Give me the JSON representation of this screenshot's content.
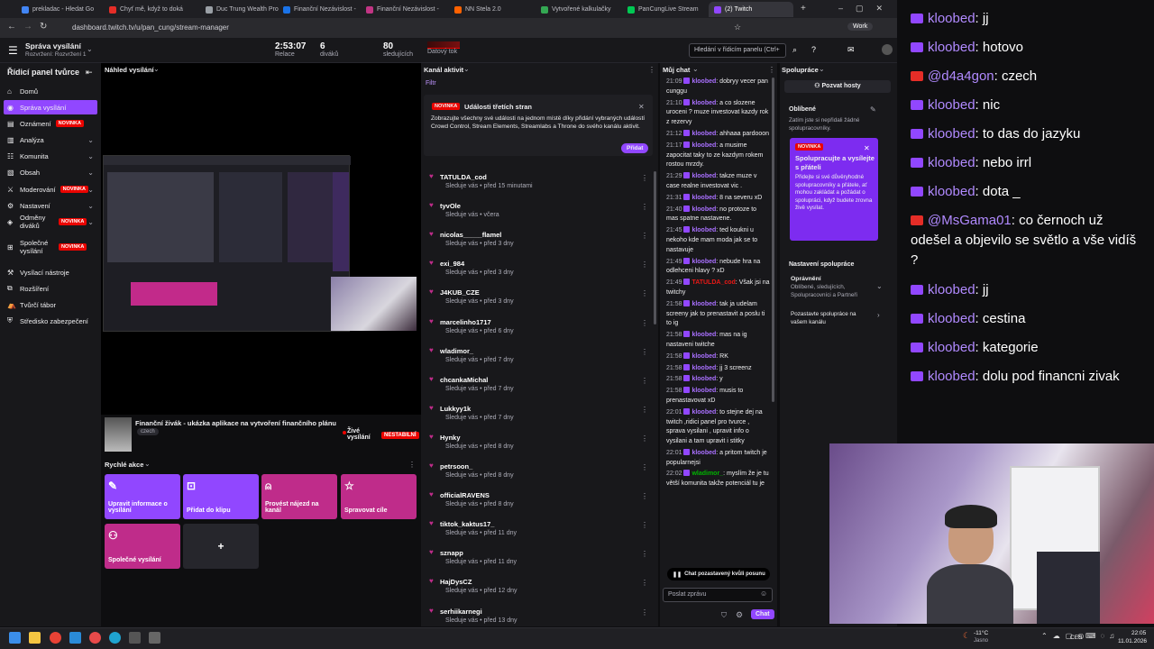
{
  "browser": {
    "tabs": [
      {
        "label": "prekladac - Hledat Go",
        "color": "#4285f4"
      },
      {
        "label": "Chyť mě, když to doká",
        "color": "#e52d27"
      },
      {
        "label": "Duc Trung Wealth Pro",
        "color": "#9aa0a6"
      },
      {
        "label": "Finanční Nezávislost -",
        "color": "#1a73e8"
      },
      {
        "label": "Finanční Nezávislost -",
        "color": "#c13584"
      },
      {
        "label": "NN Stela 2.0",
        "color": "#ff6200"
      },
      {
        "label": "Vytvořené kalkulačky",
        "color": "#34a853"
      },
      {
        "label": "PanCungLive Stream",
        "color": "#00c853"
      },
      {
        "label": "(2) Twitch",
        "color": "#9147ff"
      }
    ],
    "url": "dashboard.twitch.tv/u/pan_cung/stream-manager",
    "profile": "Work"
  },
  "twitch_header": {
    "title": "Správa vysílání",
    "subtitle": "Rozvržení: Rozvržení 1",
    "stats": [
      {
        "value": "2:53:07",
        "label": "Relace"
      },
      {
        "value": "6",
        "label": "diváků"
      },
      {
        "value": "80",
        "label": "sledujících"
      },
      {
        "value": "",
        "label": "Datový tok"
      }
    ],
    "search_placeholder": "Hledání v řídicím panelu (Ctrl+"
  },
  "left_nav": {
    "title": "Řídicí panel tvůrce",
    "items": [
      {
        "label": "Domů",
        "badge": "",
        "expand": false
      },
      {
        "label": "Správa vysílání",
        "badge": "",
        "expand": false,
        "active": true
      },
      {
        "label": "Oznámení",
        "badge": "NOVINKA",
        "expand": false
      },
      {
        "label": "Analýza",
        "badge": "",
        "expand": true
      },
      {
        "label": "Komunita",
        "badge": "",
        "expand": true
      },
      {
        "label": "Obsah",
        "badge": "",
        "expand": true
      },
      {
        "label": "Moderování",
        "badge": "NOVINKA",
        "expand": true
      },
      {
        "label": "Nastavení",
        "badge": "",
        "expand": true
      },
      {
        "label": "Odměny diváků",
        "badge": "NOVINKA",
        "expand": true
      },
      {
        "label": "Společné vysílání",
        "badge": "NOVINKA",
        "expand": false
      },
      {
        "label": "Vysílací nástroje",
        "badge": "",
        "expand": false
      },
      {
        "label": "Rozšíření",
        "badge": "",
        "expand": false
      },
      {
        "label": "Tvůrčí tábor",
        "badge": "",
        "expand": false
      },
      {
        "label": "Středisko zabezpečení",
        "badge": "",
        "expand": false
      }
    ]
  },
  "preview": {
    "header": "Náhled vysílání",
    "stream_title": "Finanční živák - ukázka aplikace na vytvoření finančního plánu",
    "language": "czech",
    "live_label": "Živé vysílání",
    "unstable_label": "NESTABILNÍ"
  },
  "quick_actions": {
    "header": "Rychlé akce",
    "items": [
      {
        "label": "Upravit informace o vysílání",
        "color": "#9147ff"
      },
      {
        "label": "Přidat do klipu",
        "color": "#9147ff"
      },
      {
        "label": "Provést nájezd na kanál",
        "color": "#bf2c8a"
      },
      {
        "label": "Spravovat cíle",
        "color": "#bf2c8a"
      },
      {
        "label": "Společné vysílání",
        "color": "#bf2c8a"
      },
      {
        "label": "+",
        "color": "#26262c"
      }
    ]
  },
  "activity": {
    "header": "Kanál aktivit",
    "filter": "Filtr",
    "promo_badge": "NOVINKA",
    "promo_title": "Události třetích stran",
    "promo_text": "Zobrazujte všechny své události na jednom místě díky přidání vybraných událostí Crowd Control, Stream Elements, Streamlabs a Throne do svého kanálu aktivit.",
    "promo_button": "Přidat",
    "followers": [
      {
        "name": "TATULDA_cod",
        "time": "Sleduje vás • před 15 minutami"
      },
      {
        "name": "tyvOle",
        "time": "Sleduje vás • včera"
      },
      {
        "name": "nicolas_____flamel",
        "time": "Sleduje vás • před 3 dny"
      },
      {
        "name": "exi_984",
        "time": "Sleduje vás • před 3 dny"
      },
      {
        "name": "J4KUB_CZE",
        "time": "Sleduje vás • před 3 dny"
      },
      {
        "name": "marcelinho1717",
        "time": "Sleduje vás • před 6 dny"
      },
      {
        "name": "wladimor_",
        "time": "Sleduje vás • před 7 dny"
      },
      {
        "name": "chcankaMichal",
        "time": "Sleduje vás • před 7 dny"
      },
      {
        "name": "Lukkyy1k",
        "time": "Sleduje vás • před 7 dny"
      },
      {
        "name": "Hynky",
        "time": "Sleduje vás • před 8 dny"
      },
      {
        "name": "petrsoon_",
        "time": "Sleduje vás • před 8 dny"
      },
      {
        "name": "officialRAVENS",
        "time": "Sleduje vás • před 8 dny"
      },
      {
        "name": "tiktok_kaktus17_",
        "time": "Sleduje vás • před 11 dny"
      },
      {
        "name": "sznapp",
        "time": "Sleduje vás • před 11 dny"
      },
      {
        "name": "HajDysCZ",
        "time": "Sleduje vás • před 12 dny"
      },
      {
        "name": "serhiikarnegi",
        "time": "Sleduje vás • před 13 dny"
      }
    ]
  },
  "my_chat": {
    "header": "Můj chat",
    "paused": "Chat pozastavený kvůli posunu",
    "input_placeholder": "Poslat zprávu",
    "send_label": "Chat",
    "messages": [
      {
        "t": "21:09",
        "u": "kloobed",
        "m": "dobryy vecer pan cunggu",
        "c": ""
      },
      {
        "t": "21:10",
        "u": "kloobed",
        "m": "a co slozene uroceni ? muze investovat kazdy rok z rezervy",
        "c": ""
      },
      {
        "t": "21:12",
        "u": "kloobed",
        "m": "ahhaaa pardooon",
        "c": ""
      },
      {
        "t": "21:17",
        "u": "kloobed",
        "m": "a musime zapocitat taky to ze kazdym rokem rostou mrzdy.",
        "c": ""
      },
      {
        "t": "21:29",
        "u": "kloobed",
        "m": "takze muze v case realne investovat vic .",
        "c": ""
      },
      {
        "t": "21:31",
        "u": "kloobed",
        "m": "8 na severu xD",
        "c": ""
      },
      {
        "t": "21:40",
        "u": "kloobed",
        "m": "no protoze to mas spatne nastavene.",
        "c": ""
      },
      {
        "t": "21:45",
        "u": "kloobed",
        "m": "ted koukni u nekoho kde mam moda jak se to nastavuje",
        "c": ""
      },
      {
        "t": "21:49",
        "u": "kloobed",
        "m": "nebude hra na odlehceni hlavy ? xD",
        "c": ""
      },
      {
        "t": "21:49",
        "u": "TATULDA_cod",
        "m": "Však jsi na twitchy",
        "c": "red"
      },
      {
        "t": "21:58",
        "u": "kloobed",
        "m": "tak ja udelam screeny jak to prenastavit a poslu ti to ig",
        "c": ""
      },
      {
        "t": "21:58",
        "u": "kloobed",
        "m": "mas na ig nastaveni twitche",
        "c": ""
      },
      {
        "t": "21:58",
        "u": "kloobed",
        "m": "RK",
        "c": ""
      },
      {
        "t": "21:58",
        "u": "kloobed",
        "m": "jj 3 screenz",
        "c": ""
      },
      {
        "t": "21:58",
        "u": "kloobed",
        "m": "y",
        "c": ""
      },
      {
        "t": "21:58",
        "u": "kloobed",
        "m": "musis to prenastavovat xD",
        "c": ""
      },
      {
        "t": "22:01",
        "u": "kloobed",
        "m": "to stejne dej na twitch ,ridici panel pro tvurce , sprava vysilani , upravit info o vysilani a tam upravit i stitky",
        "c": ""
      },
      {
        "t": "22:01",
        "u": "kloobed",
        "m": "a pritom twitch je popularnejsi",
        "c": ""
      },
      {
        "t": "22:02",
        "u": "wladimor_",
        "m": "myslím že je tu větší komunita takže potenciál tu je",
        "c": "grn"
      }
    ]
  },
  "collab": {
    "header": "Spolupráce",
    "invite": "Pozvat hosty",
    "favorites": "Oblíbené",
    "fav_text": "Zatím jste si nepřidali žádné spolupracovníky.",
    "card_badge": "NOVINKA",
    "card_title": "Spolupracujte a vysílejte s přáteli",
    "card_text": "Přidejte si své důvěryhodné spolupracovníky a přátele, ať mohou zakládat a požádat o spolupráci, když budete zrovna živě vysílat.",
    "settings": "Nastavení spolupráce",
    "perm_title": "Oprávnění",
    "perm_text": "Oblíbené, sledujících, Spolupracovníci a Partneři",
    "invite_channel": "Pozastavte spolupráce na vašem kanálu"
  },
  "overlay_chat": [
    {
      "icon": "twitch",
      "user": "kloobed",
      "msg": "jj"
    },
    {
      "icon": "twitch",
      "user": "kloobed",
      "msg": "hotovo"
    },
    {
      "icon": "youtube",
      "user": "@d4a4gon",
      "msg": "czech"
    },
    {
      "icon": "twitch",
      "user": "kloobed",
      "msg": "nic"
    },
    {
      "icon": "twitch",
      "user": "kloobed",
      "msg": "to das do jazyku"
    },
    {
      "icon": "twitch",
      "user": "kloobed",
      "msg": "nebo irrl"
    },
    {
      "icon": "twitch",
      "user": "kloobed",
      "msg": "dota _"
    },
    {
      "icon": "youtube",
      "user": "@MsGama01",
      "msg": "co černoch už odešel a objevilo se světlo a vše vidíš ?"
    },
    {
      "icon": "twitch",
      "user": "kloobed",
      "msg": "jj"
    },
    {
      "icon": "twitch",
      "user": "kloobed",
      "msg": "cestina"
    },
    {
      "icon": "twitch",
      "user": "kloobed",
      "msg": "kategorie"
    },
    {
      "icon": "twitch",
      "user": "kloobed",
      "msg": "dolu pod financni zivak"
    }
  ],
  "taskbar": {
    "weather_temp": "-11°C",
    "weather_text": "Jasno",
    "lang": "CES",
    "time": "22:05",
    "date": "11.01.2026"
  },
  "colors": {
    "twitch_purple": "#9147ff",
    "pink": "#bf2c8a",
    "bg": "#0e0e10",
    "panel": "#18181b"
  }
}
